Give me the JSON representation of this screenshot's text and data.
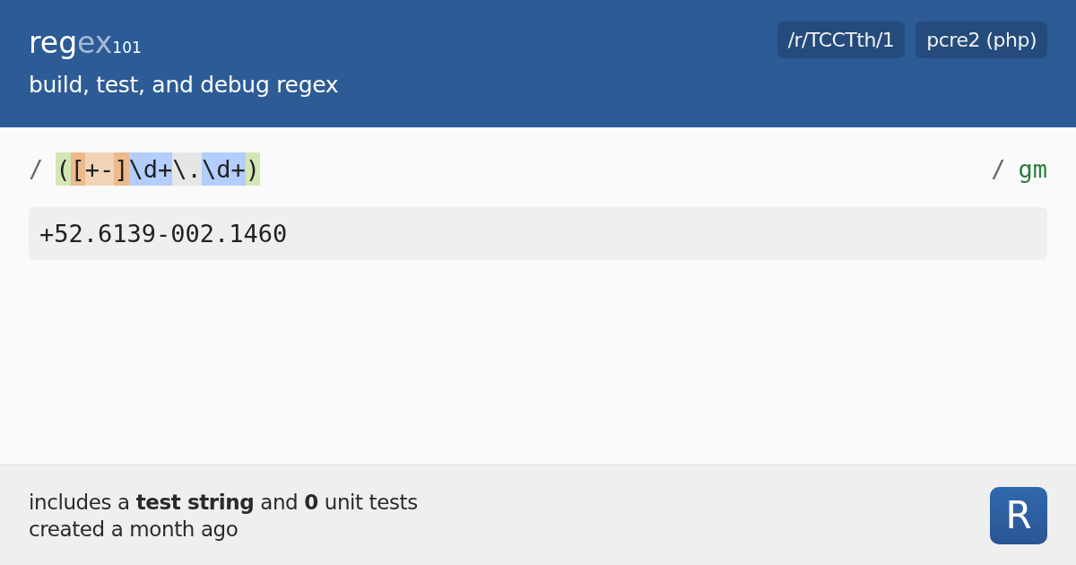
{
  "header": {
    "logo": {
      "main": "reg",
      "faded": "ex",
      "sub": "101"
    },
    "tagline": "build, test, and debug regex",
    "badges": [
      "/r/TCCTth/1",
      "pcre2 (php)"
    ]
  },
  "regex": {
    "delimiter_open": "/",
    "tokens": [
      {
        "text": "(",
        "color": "#d4e6b5"
      },
      {
        "text": "[",
        "color": "#edba8b"
      },
      {
        "text": "+-",
        "color": "#f1d4b8"
      },
      {
        "text": "]",
        "color": "#edba8b"
      },
      {
        "text": "\\d+",
        "color": "#b3cdfc"
      },
      {
        "text": "\\.",
        "color": "#e6e6e6"
      },
      {
        "text": "\\d+",
        "color": "#b3cdfc"
      },
      {
        "text": ")",
        "color": "#d4e6b5"
      }
    ],
    "delimiter_close": "/",
    "flags": "gm"
  },
  "test_string": "+52.6139-002.1460",
  "footer": {
    "summary": "includes a **test string** and **0** unit tests",
    "created": "created a month ago",
    "app_icon_letter": "R"
  }
}
